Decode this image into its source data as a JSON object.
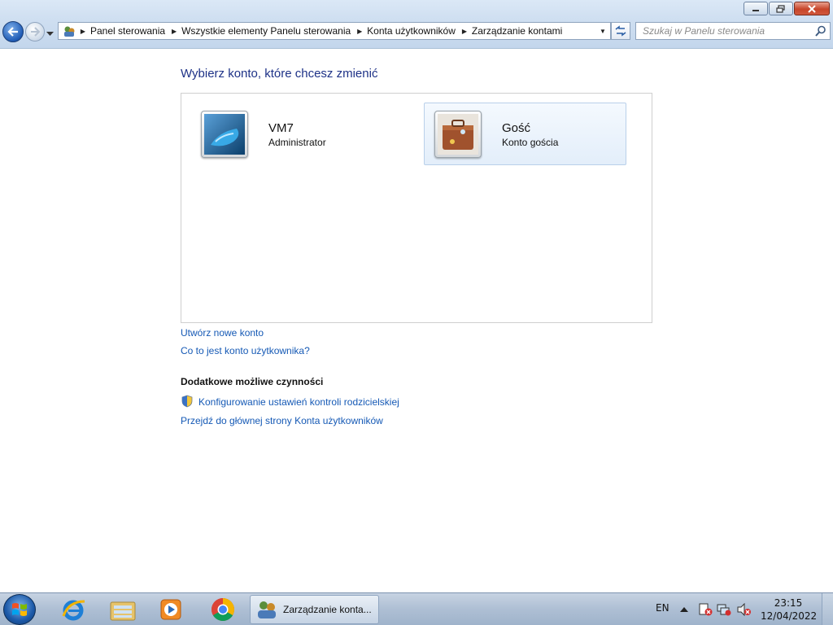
{
  "window": {
    "minimize_label": "Minimize",
    "maximize_label": "Maximize",
    "close_label": "Close"
  },
  "address": {
    "crumbs": [
      "Panel sterowania",
      "Wszystkie elementy Panelu sterowania",
      "Konta użytkowników",
      "Zarządzanie kontami"
    ]
  },
  "search": {
    "placeholder": "Szukaj w Panelu sterowania"
  },
  "main": {
    "heading": "Wybierz konto, które chcesz zmienić",
    "accounts": [
      {
        "name": "VM7",
        "role": "Administrator",
        "icon": "water-drop-avatar"
      },
      {
        "name": "Gość",
        "role": "Konto gościa",
        "icon": "suitcase-avatar"
      }
    ],
    "links": {
      "create_account": "Utwórz nowe konto",
      "what_is_account": "Co to jest konto użytkownika?"
    },
    "additional_heading": "Dodatkowe możliwe czynności",
    "additional_links": {
      "parental_controls": "Konfigurowanie ustawień kontroli rodzicielskiej",
      "user_accounts_home": "Przejdź do głównej strony Konta użytkowników"
    }
  },
  "taskbar": {
    "pinned": [
      "internet-explorer-icon",
      "file-explorer-icon",
      "media-player-icon",
      "chrome-icon"
    ],
    "active_task": "Zarządzanie konta...",
    "language": "EN",
    "time": "23:15",
    "date": "12/04/2022"
  }
}
